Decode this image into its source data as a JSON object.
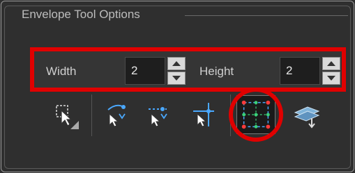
{
  "panel": {
    "title": "Envelope Tool Options"
  },
  "fields": {
    "width_label": "Width",
    "width_value": "2",
    "height_label": "Height",
    "height_value": "2"
  },
  "toolbar": {
    "buttons": [
      {
        "icon": "select-arrow-icon"
      },
      {
        "icon": "envelope-top-left-icon"
      },
      {
        "icon": "envelope-top-dotted-icon"
      },
      {
        "icon": "envelope-cross-icon"
      },
      {
        "icon": "envelope-grid-icon",
        "active": true
      },
      {
        "icon": "layers-apply-icon"
      }
    ]
  },
  "colors": {
    "highlight": "#e00000",
    "accent_blue": "#4aa8ff",
    "grid_green": "#3ad17a"
  }
}
